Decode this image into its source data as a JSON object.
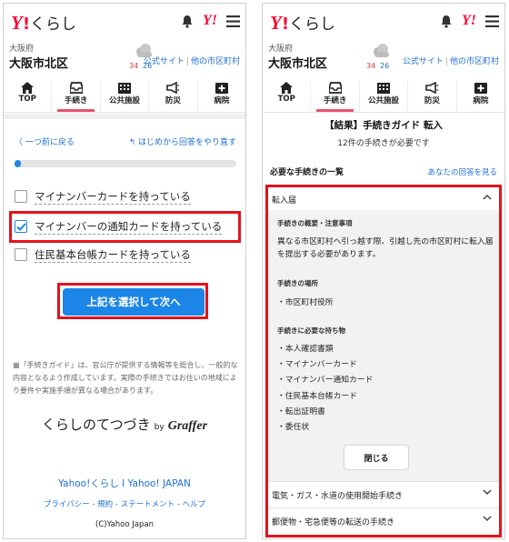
{
  "common": {
    "logo_y": "Y",
    "logo_excl": "!",
    "logo_text": "くらし",
    "header_yahoo_icon": "Y!",
    "prefecture": "大阪府",
    "city": "大阪市北区",
    "temp_high": "34",
    "temp_low": "26",
    "link_official": "公式サイト",
    "link_separator": "|",
    "link_other_city": "他の市区町村",
    "nav": [
      {
        "label": "TOP",
        "icon": "home-icon"
      },
      {
        "label": "手続き",
        "icon": "inbox-icon"
      },
      {
        "label": "公共施設",
        "icon": "building-icon"
      },
      {
        "label": "防災",
        "icon": "megaphone-icon"
      },
      {
        "label": "病院",
        "icon": "hospital-icon"
      }
    ],
    "active_nav": "手続き"
  },
  "left": {
    "back_link": "一つ前に戻る",
    "restart_link": "はじめから回答をやり直す",
    "progress": 0.03,
    "options": [
      {
        "label": "マイナンバーカードを持っている",
        "checked": false
      },
      {
        "label": "マイナンバーの通知カードを持っている",
        "checked": true
      },
      {
        "label": "住民基本台帳カードを持っている",
        "checked": false
      }
    ],
    "next_button": "上記を選択して次へ",
    "note": "「手続きガイド」は、官公庁が提供する情報等を総合し、一般的な内容となるよう作成しています。実際の手続きではお住いの地域により要件や実施手順が異なる場合があります。",
    "brand_text": "くらしのてつづき",
    "brand_by": "by",
    "brand_graffer": "Graffer",
    "footer_links": "Yahoo!くらし I Yahoo! JAPAN",
    "footer_policy": "プライバシー - 規約 - ステートメント - ヘルプ",
    "footer_copyright": "(C)Yahoo Japan"
  },
  "right": {
    "title": "【結果】手続きガイド 転入",
    "subtitle": "12件の手続きが必要です",
    "list_heading": "必要な手続きの一覧",
    "your_answers": "あなたの回答を見る",
    "accordion": {
      "expanded_title": "転入届",
      "section_overview": "手続きの概要・注意事項",
      "overview_text": "異なる市区町村へ引っ越す際、引越し先の市区町村に転入届を提出する必要があります。",
      "section_place": "手続きの場所",
      "place_text": "・市区町村役所",
      "section_items": "手続きに必要な持ち物",
      "items": [
        "・本人確認書類",
        "・マイナンバーカード",
        "・マイナンバー通知カード",
        "・住民基本台帳カード",
        "・転出証明書",
        "・委任状"
      ],
      "close_button": "閉じる",
      "collapsed": [
        "電気・ガス・水道の使用開始手続き",
        "郵便物・宅急便等の転送の手続き"
      ]
    }
  }
}
